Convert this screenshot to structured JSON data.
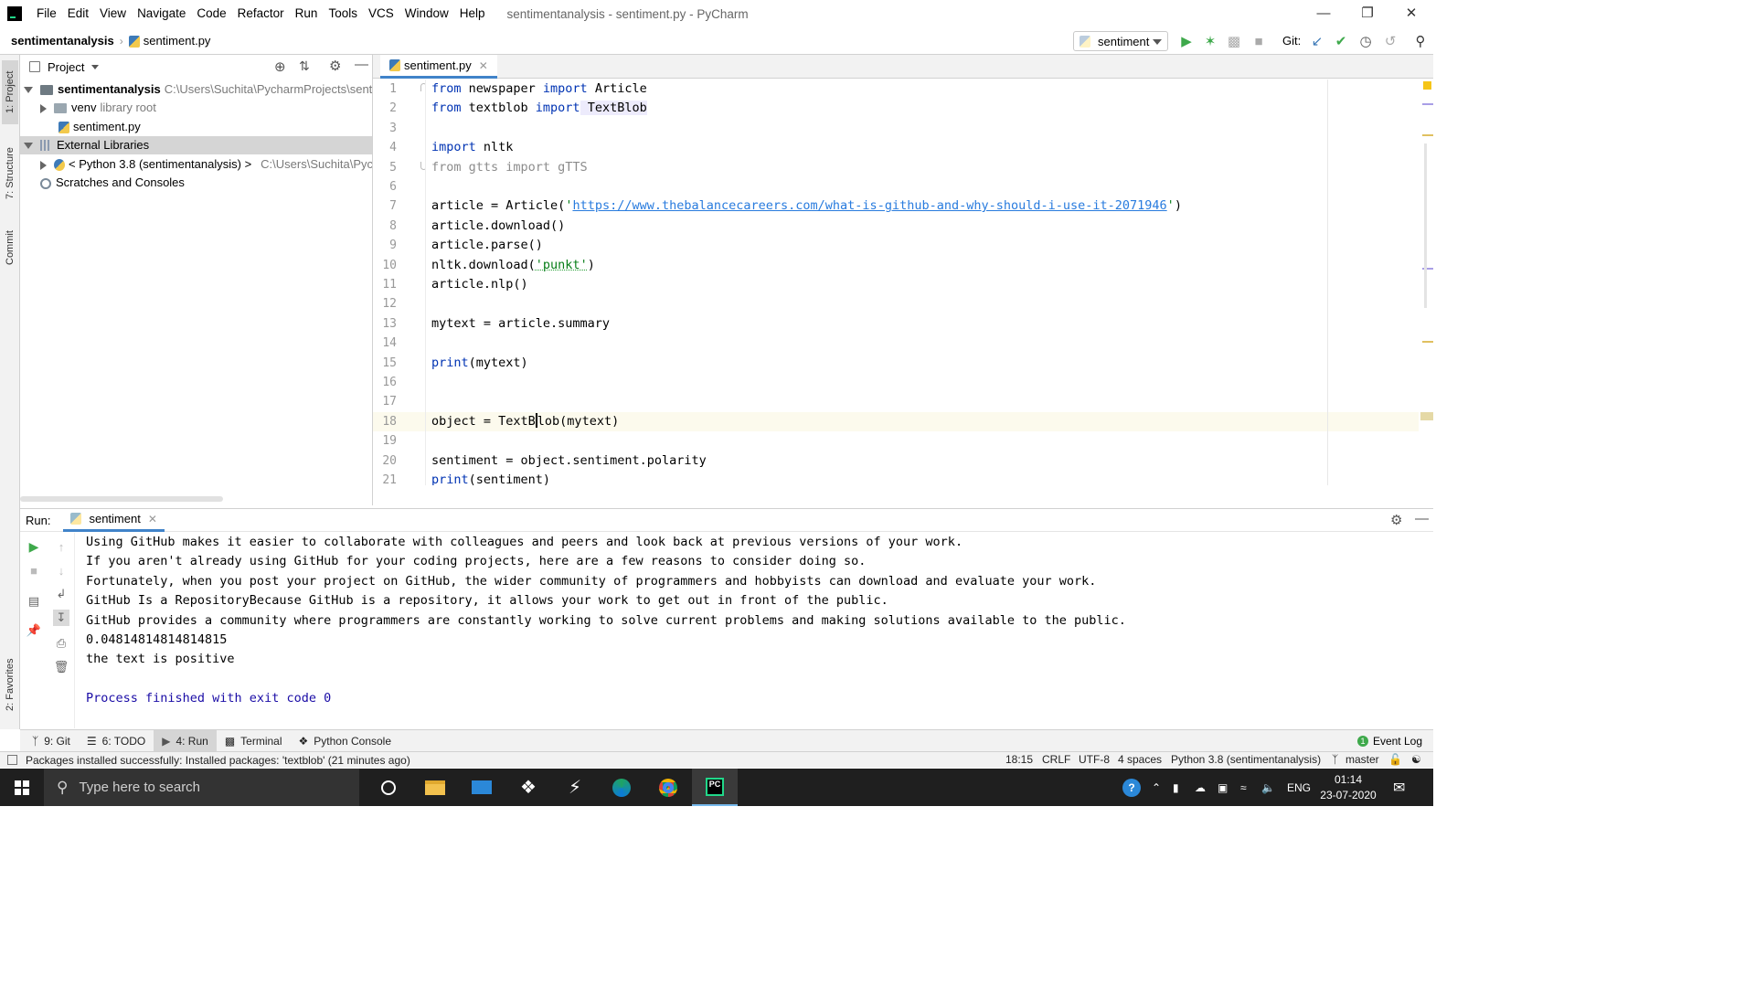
{
  "window": {
    "title": "sentimentanalysis - sentiment.py - PyCharm",
    "menu": [
      "File",
      "Edit",
      "View",
      "Navigate",
      "Code",
      "Refactor",
      "Run",
      "Tools",
      "VCS",
      "Window",
      "Help"
    ]
  },
  "navbar": {
    "project": "sentimentanalysis",
    "file": "sentiment.py",
    "run_config": "sentiment",
    "git_label": "Git:"
  },
  "left_strip": {
    "project_tab": "1: Project",
    "structure_tab": "7: Structure",
    "commit_tab": "Commit",
    "favorites_tab": "2: Favorites"
  },
  "project_panel": {
    "title": "Project",
    "tree": [
      {
        "label": "sentimentanalysis",
        "hint": "C:\\Users\\Suchita\\PycharmProjects\\sentiment"
      },
      {
        "label": "venv",
        "hint": "library root"
      },
      {
        "label": "sentiment.py",
        "hint": ""
      },
      {
        "label": "External Libraries",
        "hint": ""
      },
      {
        "label": "< Python 3.8 (sentimentanalysis) >",
        "hint": "C:\\Users\\Suchita\\Pycharm"
      },
      {
        "label": "Scratches and Consoles",
        "hint": ""
      }
    ]
  },
  "editor": {
    "tab": "sentiment.py",
    "line_numbers": [
      "1",
      "2",
      "3",
      "4",
      "5",
      "6",
      "7",
      "8",
      "9",
      "10",
      "11",
      "12",
      "13",
      "14",
      "15",
      "16",
      "17",
      "18",
      "19",
      "20",
      "21"
    ],
    "lines": {
      "l1a": "from",
      "l1b": " newspaper ",
      "l1c": "import",
      "l1d": " Article",
      "l2a": "from",
      "l2b": " textblob ",
      "l2c": "import",
      "l2d": " TextBlob",
      "l4a": "import",
      "l4b": " nltk",
      "l5": "from gtts import gTTS",
      "l7a": "article = Article(",
      "l7b": "'",
      "l7c": "https://www.thebalancecareers.com/what-is-github-and-why-should-i-use-it-2071946",
      "l7d": "'",
      "l7e": ")",
      "l8": "article.download()",
      "l9": "article.parse()",
      "l10a": "nltk.download(",
      "l10b": "'punkt'",
      "l10c": ")",
      "l11": "article.nlp()",
      "l13": "mytext = article.summary",
      "l15a": "print",
      "l15b": "(mytext)",
      "l18a": "object = TextB",
      "l18b": "lob(mytext)",
      "l20": "sentiment = object.sentiment.polarity",
      "l21a": "print",
      "l21b": "(sentiment)"
    }
  },
  "run_panel": {
    "label": "Run:",
    "tab": "sentiment",
    "output": [
      "Using GitHub makes it easier to collaborate with colleagues and peers and look back at previous versions of your work.",
      "If you aren't already using GitHub for your coding projects, here are a few reasons to consider doing so.",
      "Fortunately, when you post your project on GitHub, the wider community of programmers and hobbyists can download and evaluate your work.",
      "GitHub Is a RepositoryBecause GitHub is a repository, it allows your work to get out in front of the public.",
      "GitHub provides a community where programmers are constantly working to solve current problems and making solutions available to the public.",
      "0.04814814814814815",
      "the text is positive",
      "",
      "Process finished with exit code 0"
    ]
  },
  "bottom_tabs": {
    "git": "9: Git",
    "todo": "6: TODO",
    "run": "4: Run",
    "terminal": "Terminal",
    "python_console": "Python Console",
    "event_log": "Event Log",
    "event_count": "1"
  },
  "statusbar": {
    "message": "Packages installed successfully: Installed packages: 'textblob' (21 minutes ago)",
    "position": "18:15",
    "line_sep": "CRLF",
    "encoding": "UTF-8",
    "indent": "4 spaces",
    "interpreter": "Python 3.8 (sentimentanalysis)",
    "branch": "master"
  },
  "taskbar": {
    "search_placeholder": "Type here to search",
    "lang": "ENG",
    "time": "01:14",
    "date": "23-07-2020"
  },
  "colors": {
    "keyword": "#0033b3",
    "string": "#067d17",
    "url": "#287bde",
    "exit_text": "#1a0ca6",
    "accent": "#4083c9"
  }
}
